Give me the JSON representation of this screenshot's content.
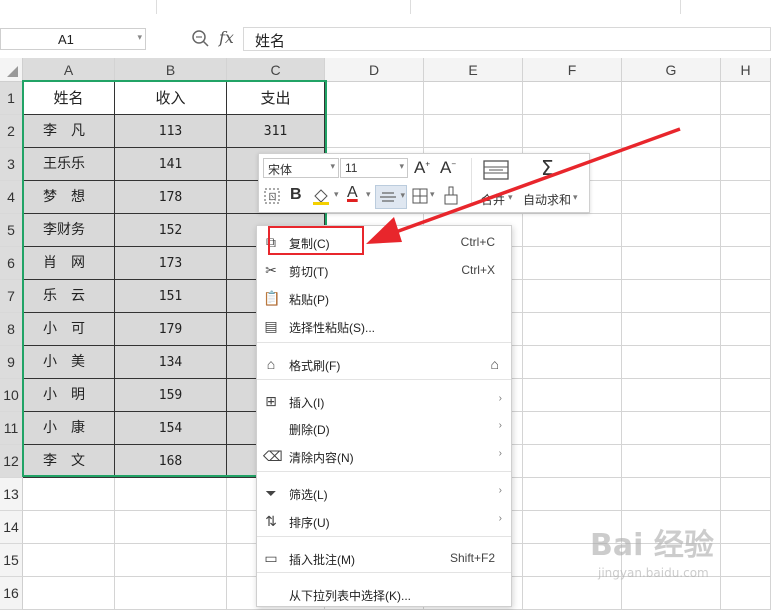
{
  "formula_bar": {
    "name_box": "A1",
    "formula_value": "姓名",
    "zoom_icon": "magnifier-icon",
    "fx_label": "fx"
  },
  "columns": [
    "A",
    "B",
    "C",
    "D",
    "E",
    "F",
    "G",
    "H"
  ],
  "rows": [
    "1",
    "2",
    "3",
    "4",
    "5",
    "6",
    "7",
    "8",
    "9",
    "10",
    "11",
    "12",
    "13",
    "14",
    "15",
    "16"
  ],
  "sheet": {
    "header": [
      "姓名",
      "收入",
      "支出"
    ],
    "data": [
      {
        "name": "李　凡",
        "income": "113",
        "expense": "311"
      },
      {
        "name": "王乐乐",
        "income": "141",
        "expense": ""
      },
      {
        "name": "梦　想",
        "income": "178",
        "expense": ""
      },
      {
        "name": "李财务",
        "income": "152",
        "expense": ""
      },
      {
        "name": "肖　网",
        "income": "173",
        "expense": ""
      },
      {
        "name": "乐　云",
        "income": "151",
        "expense": ""
      },
      {
        "name": "小　可",
        "income": "179",
        "expense": ""
      },
      {
        "name": "小　美",
        "income": "134",
        "expense": ""
      },
      {
        "name": "小　明",
        "income": "159",
        "expense": ""
      },
      {
        "name": "小　康",
        "income": "154",
        "expense": ""
      },
      {
        "name": "李　文",
        "income": "168",
        "expense": ""
      }
    ]
  },
  "mini_toolbar": {
    "font_name": "宋体",
    "font_size": "11",
    "merge_label": "合并",
    "autosum_label": "自动求和"
  },
  "context_menu": {
    "items": [
      {
        "label": "复制(C)",
        "shortcut": "Ctrl+C",
        "icon": "copy-icon"
      },
      {
        "label": "剪切(T)",
        "shortcut": "Ctrl+X",
        "icon": "scissors-icon"
      },
      {
        "label": "粘贴(P)",
        "shortcut": "",
        "icon": "paste-icon"
      },
      {
        "label": "选择性粘贴(S)...",
        "shortcut": "",
        "icon": "paste-special-icon"
      },
      {
        "label": "格式刷(F)",
        "shortcut": "",
        "icon": "format-brush-icon"
      },
      {
        "label": "插入(I)",
        "shortcut": "",
        "icon": "insert-icon"
      },
      {
        "label": "删除(D)",
        "shortcut": "",
        "icon": ""
      },
      {
        "label": "清除内容(N)",
        "shortcut": "",
        "icon": "eraser-icon"
      },
      {
        "label": "筛选(L)",
        "shortcut": "",
        "icon": "filter-icon"
      },
      {
        "label": "排序(U)",
        "shortcut": "",
        "icon": "sort-icon"
      },
      {
        "label": "插入批注(M)",
        "shortcut": "Shift+F2",
        "icon": "comment-icon"
      },
      {
        "label": "从下拉列表中选择(K)...",
        "shortcut": "",
        "icon": ""
      }
    ]
  },
  "watermark": {
    "text": "Bai 经验",
    "sub": "jingyan.baidu.com"
  },
  "colors": {
    "selection": "#21a366",
    "highlight": "#e8262c",
    "data_fill": "#d9d9d9"
  }
}
